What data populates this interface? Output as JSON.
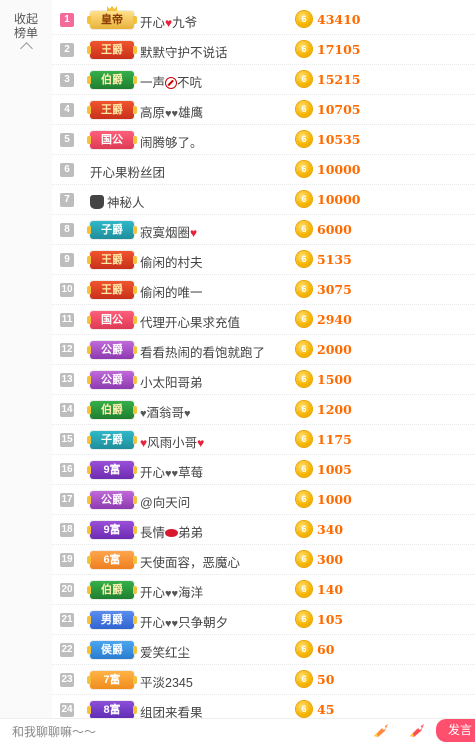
{
  "sidebar": {
    "collapse_label": "收起榜单"
  },
  "colors": {
    "rank_top": "#f46b9b",
    "amount": "#ff6a00",
    "coin": "#f5b400",
    "send_button": "#ff4f6f"
  },
  "rows": [
    {
      "rank": "1",
      "badge": "皇帝",
      "badge_style": "emperor",
      "pre": "",
      "name": "开心",
      "icon": "heart",
      "post": "九爷",
      "amount": "43410",
      "top": true
    },
    {
      "rank": "2",
      "badge": "王爵",
      "badge_style": "red",
      "pre": "",
      "name": "默默守护不说话",
      "icon": "",
      "post": "",
      "amount": "17105"
    },
    {
      "rank": "3",
      "badge": "伯爵",
      "badge_style": "green",
      "pre": "",
      "name": "一声",
      "icon": "ban",
      "post": "不吭",
      "amount": "15215"
    },
    {
      "rank": "4",
      "badge": "王爵",
      "badge_style": "red",
      "pre": "",
      "name": "高原",
      "icon": "gheart2",
      "post": "雄鹰",
      "amount": "10705"
    },
    {
      "rank": "5",
      "badge": "国公",
      "badge_style": "pinkred",
      "pre": "",
      "name": "闹腾够了。",
      "icon": "",
      "post": "",
      "amount": "10535"
    },
    {
      "rank": "6",
      "badge": "",
      "badge_style": "",
      "pre": "",
      "name": "开心果粉丝团",
      "icon": "",
      "post": "",
      "amount": "10000"
    },
    {
      "rank": "7",
      "badge": "",
      "badge_style": "",
      "pre": "spy",
      "name": "神秘人",
      "icon": "",
      "post": "",
      "amount": "10000"
    },
    {
      "rank": "8",
      "badge": "子爵",
      "badge_style": "teal",
      "pre": "",
      "name": "寂寞烟圈",
      "icon": "heart",
      "post": "",
      "amount": "6000"
    },
    {
      "rank": "9",
      "badge": "王爵",
      "badge_style": "red",
      "pre": "",
      "name": "偷闲的村夫",
      "icon": "",
      "post": "",
      "amount": "5135"
    },
    {
      "rank": "10",
      "badge": "王爵",
      "badge_style": "red",
      "pre": "",
      "name": "偷闲的唯一",
      "icon": "",
      "post": "",
      "amount": "3075"
    },
    {
      "rank": "11",
      "badge": "国公",
      "badge_style": "pinkred",
      "pre": "",
      "name": "代理开心果求充值",
      "icon": "",
      "post": "",
      "amount": "2940"
    },
    {
      "rank": "12",
      "badge": "公爵",
      "badge_style": "purple",
      "pre": "",
      "name": "看看热闹的看饱就跑了",
      "icon": "",
      "post": "",
      "amount": "2000"
    },
    {
      "rank": "13",
      "badge": "公爵",
      "badge_style": "purple",
      "pre": "",
      "name": "小太阳哥弟",
      "icon": "",
      "post": "",
      "amount": "1500"
    },
    {
      "rank": "14",
      "badge": "伯爵",
      "badge_style": "green",
      "pre": "gheart",
      "name": "酒翁哥",
      "icon": "gheart",
      "post": "",
      "amount": "1200"
    },
    {
      "rank": "15",
      "badge": "子爵",
      "badge_style": "teal",
      "pre": "heart",
      "name": "风雨小哥",
      "icon": "heart",
      "post": "",
      "amount": "1175"
    },
    {
      "rank": "16",
      "badge": "9富",
      "badge_style": "purple2",
      "pre": "",
      "name": "开心",
      "icon": "gheart2",
      "post": "草莓",
      "amount": "1005"
    },
    {
      "rank": "17",
      "badge": "公爵",
      "badge_style": "purple",
      "pre": "",
      "name": "@向天问",
      "icon": "",
      "post": "",
      "amount": "1000"
    },
    {
      "rank": "18",
      "badge": "9富",
      "badge_style": "purple2",
      "pre": "",
      "name": "長情",
      "icon": "lips",
      "post": "弟弟",
      "amount": "340"
    },
    {
      "rank": "19",
      "badge": "6富",
      "badge_style": "orange",
      "pre": "",
      "name": "天使面容，恶魔心",
      "icon": "",
      "post": "",
      "amount": "300"
    },
    {
      "rank": "20",
      "badge": "伯爵",
      "badge_style": "green",
      "pre": "",
      "name": "开心",
      "icon": "gheart2",
      "post": "海洋",
      "amount": "140"
    },
    {
      "rank": "21",
      "badge": "男爵",
      "badge_style": "blue",
      "pre": "",
      "name": "开心",
      "icon": "gheart2",
      "post": "只争朝夕",
      "amount": "105"
    },
    {
      "rank": "22",
      "badge": "侯爵",
      "badge_style": "blue2",
      "pre": "",
      "name": "爱笑红尘",
      "icon": "",
      "post": "",
      "amount": "60"
    },
    {
      "rank": "23",
      "badge": "7富",
      "badge_style": "orange2",
      "pre": "",
      "name": "平淡2345",
      "icon": "",
      "post": "",
      "amount": "50"
    },
    {
      "rank": "24",
      "badge": "8富",
      "badge_style": "purple3",
      "pre": "",
      "name": "组团来看果",
      "icon": "",
      "post": "",
      "amount": "45"
    }
  ],
  "coin_label": "6",
  "footer": {
    "chat_placeholder": "和我聊聊嘛～～",
    "send_label": "发言"
  }
}
